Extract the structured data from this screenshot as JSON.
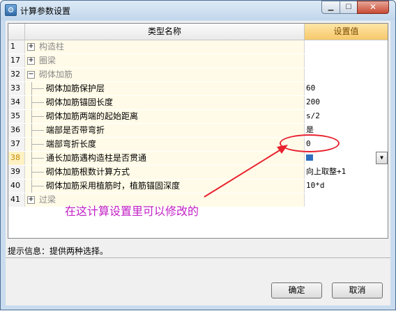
{
  "window": {
    "title": "计算参数设置",
    "app_icon": "settings-app-icon",
    "minimize_label": "▁",
    "maximize_label": "☐",
    "close_label": "✕"
  },
  "grid": {
    "columns": {
      "name": "类型名称",
      "value": "设置值"
    },
    "rows": [
      {
        "num": "1",
        "type": "group",
        "expander": "+",
        "name": "构造柱",
        "value": ""
      },
      {
        "num": "17",
        "type": "group",
        "expander": "+",
        "name": "圈梁",
        "value": ""
      },
      {
        "num": "32",
        "type": "group",
        "expander": "−",
        "name": "砌体加筋",
        "value": ""
      },
      {
        "num": "33",
        "type": "child",
        "name": "砌体加筋保护层",
        "value": "60"
      },
      {
        "num": "34",
        "type": "child",
        "name": "砌体加筋锚固长度",
        "value": "200"
      },
      {
        "num": "35",
        "type": "child",
        "name": "砌体加筋两端的起始距离",
        "value": "s/2"
      },
      {
        "num": "36",
        "type": "child",
        "name": "端部是否带弯折",
        "value": "是"
      },
      {
        "num": "37",
        "type": "child",
        "name": "端部弯折长度",
        "value": "0"
      },
      {
        "num": "38",
        "type": "child",
        "name": "通长加筋遇构造柱是否贯通",
        "value": "",
        "selected": true
      },
      {
        "num": "39",
        "type": "child",
        "name": "砌体加筋根数计算方式",
        "value": "向上取整+1"
      },
      {
        "num": "40",
        "type": "child",
        "name": "砌体加筋采用植筋时，植筋锚固深度",
        "value": "10*d"
      },
      {
        "num": "41",
        "type": "group",
        "expander": "+",
        "name": "过梁",
        "value": ""
      }
    ]
  },
  "annotation": {
    "text": "在这计算设置里可以修改的",
    "color": "#c21fc5",
    "marker_color": "#e8222e"
  },
  "hint": {
    "text": "提示信息：提供两种选择。"
  },
  "buttons": {
    "ok": "确定",
    "cancel": "取消"
  }
}
